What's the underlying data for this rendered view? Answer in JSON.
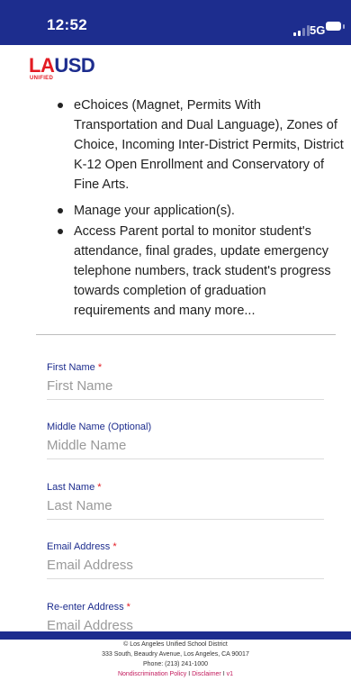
{
  "status": {
    "time": "12:52",
    "network": "5G"
  },
  "header": {
    "logo_la": "LA",
    "logo_usd": "USD",
    "logo_sub": "UNIFIED"
  },
  "bullets": [
    "eChoices (Magnet, Permits With Transportation and Dual Language), Zones of Choice, Incoming Inter-District Permits, District K-12 Open Enrollment and Conservatory of Fine Arts.",
    "Manage your application(s).",
    "Access Parent portal to monitor student's attendance, final grades, update emergency telephone numbers, track student's progress towards completion of graduation requirements and many more..."
  ],
  "form": {
    "first_name": {
      "label": "First Name",
      "required": "*",
      "placeholder": "First Name"
    },
    "middle_name": {
      "label": "Middle Name (Optional)",
      "placeholder": "Middle Name"
    },
    "last_name": {
      "label": "Last Name",
      "required": "*",
      "placeholder": "Last Name"
    },
    "email": {
      "label": "Email Address",
      "required": "*",
      "placeholder": "Email Address"
    },
    "email_confirm": {
      "label": "Re-enter Address",
      "required": "*",
      "placeholder": "Email Address"
    }
  },
  "footer": {
    "copyright": "© Los Angeles Unified School District",
    "address": "333 South, Beaudry Avenue, Los Angeles, CA 90017",
    "phone": "Phone: (213) 241-1000",
    "nondiscrimination": "Nondiscrimination Policy",
    "separator": "I",
    "disclaimer": "Disclaimer",
    "version": "v1"
  },
  "colors": {
    "brand_blue": "#1d2d8e",
    "brand_red": "#e31b23",
    "link_pink": "#c2185b"
  }
}
